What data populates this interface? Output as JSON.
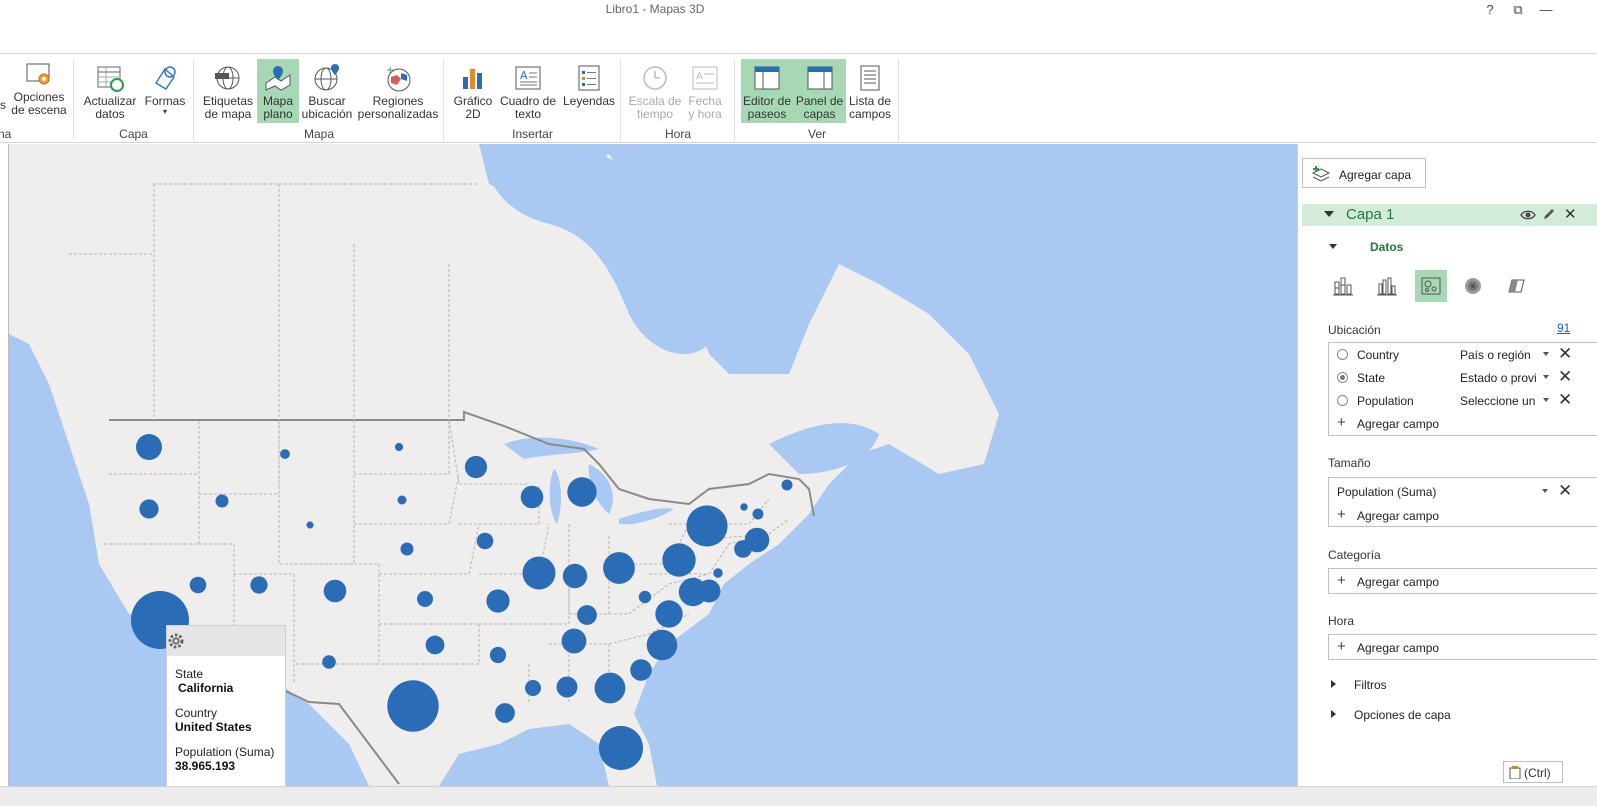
{
  "window": {
    "title": "Libro1 - Mapas 3D",
    "help_glyph": "?",
    "restore_glyph": "⧉",
    "minimize_glyph": "—"
  },
  "ribbon": {
    "partial_label_left": "s",
    "partial_group_left": "na",
    "groups": [
      {
        "label": "Capa",
        "buttons": [
          {
            "label": "Actualizar datos",
            "icon": "refresh-data-icon"
          },
          {
            "label": "Formas",
            "icon": "shapes-icon"
          }
        ]
      },
      {
        "label": "Mapa",
        "buttons": [
          {
            "label": "Etiquetas de mapa",
            "icon": "map-labels-icon"
          },
          {
            "label": "Mapa plano",
            "icon": "flat-map-icon",
            "active": true
          },
          {
            "label": "Buscar ubicación",
            "icon": "find-location-icon"
          },
          {
            "label": "Regiones personalizadas",
            "icon": "custom-regions-icon"
          }
        ]
      },
      {
        "label": "Insertar",
        "buttons": [
          {
            "label": "Gráfico 2D",
            "icon": "chart-2d-icon"
          },
          {
            "label": "Cuadro de texto",
            "icon": "text-box-icon"
          },
          {
            "label": "Leyendas",
            "icon": "legend-icon"
          }
        ]
      },
      {
        "label": "Hora",
        "buttons": [
          {
            "label": "Escala de tiempo",
            "icon": "timeline-icon",
            "disabled": true
          },
          {
            "label": "Fecha y hora",
            "icon": "date-time-icon",
            "disabled": true
          }
        ]
      },
      {
        "label": "Ver",
        "buttons": [
          {
            "label": "Editor de paseos",
            "icon": "tour-editor-icon",
            "active": true
          },
          {
            "label": "Panel de capas",
            "icon": "layer-pane-icon",
            "active": true
          },
          {
            "label": "Lista de campos",
            "icon": "field-list-icon"
          }
        ]
      }
    ],
    "scene_options": {
      "label": "Opciones de escena",
      "icon": "scene-options-icon"
    }
  },
  "tooltip": {
    "state_label": "State",
    "state_value": "California",
    "country_label": "Country",
    "country_value": "United States",
    "pop_label": "Population (Suma)",
    "pop_value": "38.965.193"
  },
  "pane": {
    "add_layer": "Agregar capa",
    "layer_name": "Capa 1",
    "datos": "Datos",
    "viz_types": [
      "stacked-column-icon",
      "clustered-column-icon",
      "bubble-icon",
      "heat-map-icon",
      "region-icon"
    ],
    "location": {
      "label": "Ubicación",
      "link_partial": "91",
      "fields": [
        {
          "name": "Country",
          "type": "País o región",
          "selected": false
        },
        {
          "name": "State",
          "type": "Estado o provi",
          "selected": true
        },
        {
          "name": "Population",
          "type": "Seleccione un",
          "selected": false
        }
      ],
      "add_field": "Agregar campo"
    },
    "size": {
      "label": "Tamaño",
      "field": "Population (Suma)",
      "add_field": "Agregar campo"
    },
    "category": {
      "label": "Categoría",
      "add_field": "Agregar campo"
    },
    "time": {
      "label": "Hora",
      "add_field": "Agregar campo"
    },
    "filters": "Filtros",
    "layer_options": "Opciones de capa",
    "ctrl": "(Ctrl)"
  },
  "map": {
    "water_color": "#a9c8f2",
    "land_color": "#efeeec",
    "bubble_color": "#2b6cb6",
    "bubbles": [
      {
        "state": "Washington",
        "population": 7812880
      },
      {
        "state": "Oregon",
        "population": 4233358
      },
      {
        "state": "California",
        "population": 38965193
      },
      {
        "state": "Nevada",
        "population": 3194176
      },
      {
        "state": "Idaho",
        "population": 1964726
      },
      {
        "state": "Montana",
        "population": 1132812
      },
      {
        "state": "Wyoming",
        "population": 584057
      },
      {
        "state": "Utah",
        "population": 3417734
      },
      {
        "state": "Arizona",
        "population": 7431344
      },
      {
        "state": "Colorado",
        "population": 5877610
      },
      {
        "state": "New Mexico",
        "population": 2114371
      },
      {
        "state": "North Dakota",
        "population": 783926
      },
      {
        "state": "South Dakota",
        "population": 919318
      },
      {
        "state": "Nebraska",
        "population": 1978379
      },
      {
        "state": "Kansas",
        "population": 2940546
      },
      {
        "state": "Oklahoma",
        "population": 4053824
      },
      {
        "state": "Texas",
        "population": 30503301
      },
      {
        "state": "Minnesota",
        "population": 5737915
      },
      {
        "state": "Iowa",
        "population": 3207004
      },
      {
        "state": "Missouri",
        "population": 6196156
      },
      {
        "state": "Arkansas",
        "population": 3067732
      },
      {
        "state": "Louisiana",
        "population": 4573749
      },
      {
        "state": "Wisconsin",
        "population": 5910955
      },
      {
        "state": "Illinois",
        "population": 12549689
      },
      {
        "state": "Michigan",
        "population": 10037261
      },
      {
        "state": "Indiana",
        "population": 6862199
      },
      {
        "state": "Ohio",
        "population": 11785935
      },
      {
        "state": "Kentucky",
        "population": 4526154
      },
      {
        "state": "Tennessee",
        "population": 7126489
      },
      {
        "state": "Mississippi",
        "population": 2939690
      },
      {
        "state": "Alabama",
        "population": 5108468
      },
      {
        "state": "Georgia",
        "population": 11029227
      },
      {
        "state": "Florida",
        "population": 22610726
      },
      {
        "state": "South Carolina",
        "population": 5373555
      },
      {
        "state": "North Carolina",
        "population": 10835491
      },
      {
        "state": "Virginia",
        "population": 8715698
      },
      {
        "state": "West Virginia",
        "population": 1770071
      },
      {
        "state": "Pennsylvania",
        "population": 12961683
      },
      {
        "state": "New York",
        "population": 19571216
      },
      {
        "state": "New Jersey",
        "population": 9290841
      },
      {
        "state": "Maryland",
        "population": 6180253
      },
      {
        "state": "Delaware",
        "population": 1031890
      },
      {
        "state": "Massachusetts",
        "population": 7001399
      },
      {
        "state": "Connecticut",
        "population": 3617176
      },
      {
        "state": "Vermont",
        "population": 647464
      },
      {
        "state": "New Hampshire",
        "population": 1402054
      },
      {
        "state": "Maine",
        "population": 1395722
      }
    ]
  }
}
